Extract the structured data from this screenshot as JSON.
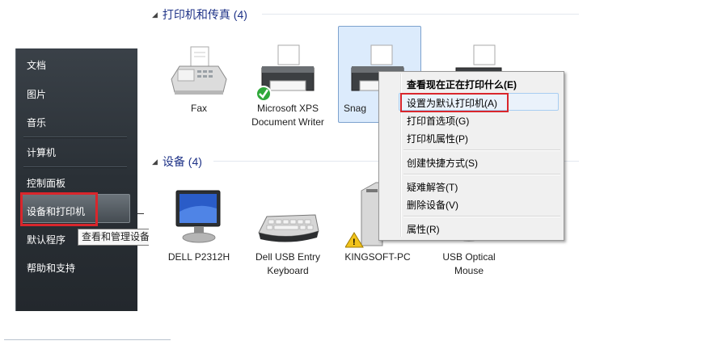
{
  "start_menu": {
    "items": [
      {
        "label": "文档"
      },
      {
        "label": "图片"
      },
      {
        "label": "音乐"
      },
      {
        "label": "计算机"
      },
      {
        "label": "控制面板"
      },
      {
        "label": "设备和打印机"
      },
      {
        "label": "默认程序"
      },
      {
        "label": "帮助和支持"
      }
    ],
    "tooltip": "查看和管理设备"
  },
  "explorer": {
    "groups": {
      "printers": {
        "title": "打印机和传真 (4)"
      },
      "devices": {
        "title": "设备 (4)"
      }
    },
    "printers": [
      {
        "name": "Fax",
        "icon": "fax-icon"
      },
      {
        "name": "Microsoft XPS Document Writer",
        "icon": "printer-icon",
        "badge": "default-checkmark"
      },
      {
        "name": "Snag",
        "icon": "printer-icon",
        "selected": true
      },
      {
        "name": "",
        "icon": "printer-icon"
      }
    ],
    "devices": [
      {
        "name": "DELL P2312H",
        "icon": "monitor-icon"
      },
      {
        "name": "Dell USB Entry Keyboard",
        "icon": "keyboard-icon"
      },
      {
        "name": "KINGSOFT-PC",
        "icon": "computer-tower-icon",
        "badge": "warning"
      },
      {
        "name": "USB Optical Mouse",
        "icon": "mouse-icon"
      }
    ]
  },
  "context_menu": {
    "items": [
      {
        "label": "查看现在正在打印什么(E)",
        "bold": true
      },
      {
        "label": "设置为默认打印机(A)",
        "highlighted": true
      },
      {
        "label": "打印首选项(G)"
      },
      {
        "label": "打印机属性(P)"
      },
      {
        "label": "创建快捷方式(S)"
      },
      {
        "label": "疑难解答(T)"
      },
      {
        "label": "删除设备(V)"
      },
      {
        "label": "属性(R)"
      }
    ]
  },
  "colors": {
    "annotation_red": "#d9262c",
    "group_header": "#1e3287",
    "selection_bg": "#dcebfc",
    "start_menu_bg": "#2a3036"
  }
}
